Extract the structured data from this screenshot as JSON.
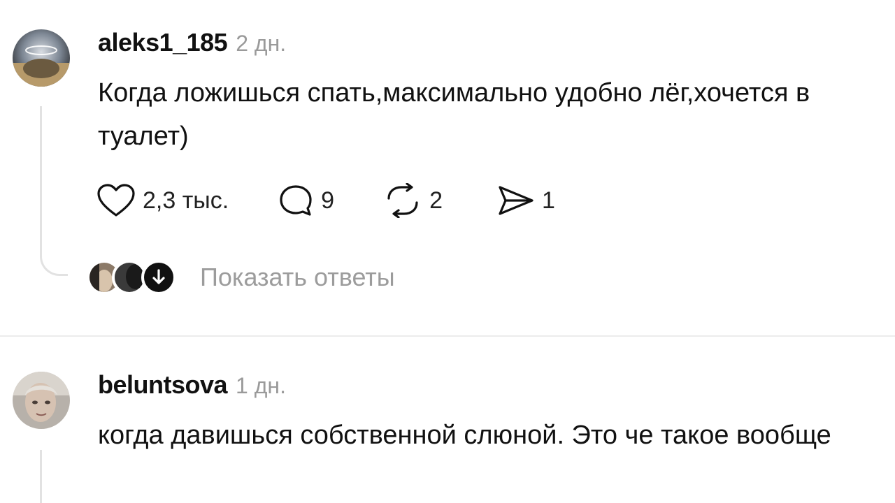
{
  "comments": [
    {
      "username": "aleks1_185",
      "time": "2 дн.",
      "text": "Когда ложишься спать,максимально удобно лёг,хочется в туалет)",
      "actions": {
        "likes": "2,3 тыс.",
        "replies": "9",
        "reposts": "2",
        "shares": "1"
      },
      "show_replies_label": "Показать ответы"
    },
    {
      "username": "beluntsova",
      "time": "1 дн.",
      "text": "когда давишься собственной слюной. Это че такое вообще"
    }
  ],
  "icons": {
    "like": "heart-icon",
    "reply": "speech-bubble-icon",
    "repost": "repost-icon",
    "share": "send-icon",
    "expand": "arrow-down-icon"
  },
  "colors": {
    "text": "#111111",
    "muted": "#9a9a9a",
    "thread": "#e2e2e2"
  }
}
